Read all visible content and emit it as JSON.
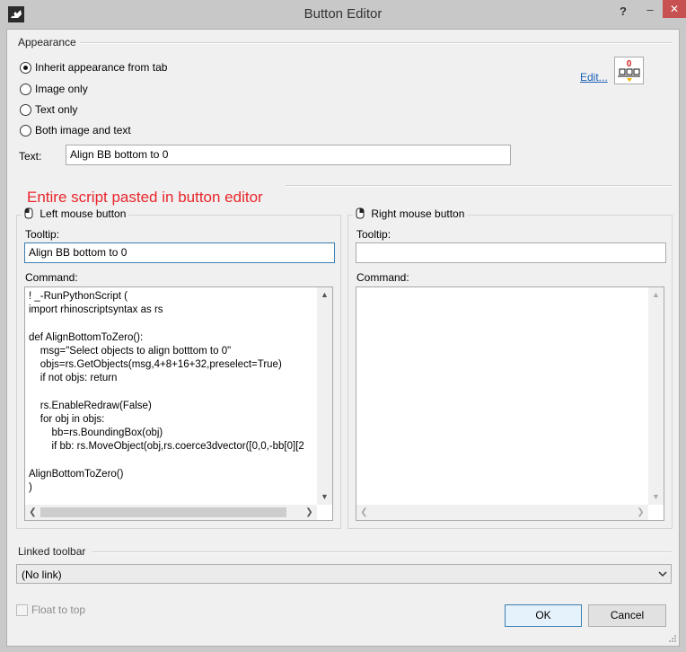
{
  "window": {
    "title": "Button Editor",
    "help_label": "?",
    "minimize_label": "–",
    "close_label": "✕",
    "close_color": "#c75050"
  },
  "appearance": {
    "section_label": "Appearance",
    "options": [
      {
        "label": "Inherit appearance from tab",
        "checked": true
      },
      {
        "label": "Image only",
        "checked": false
      },
      {
        "label": "Text only",
        "checked": false
      },
      {
        "label": "Both image and text",
        "checked": false
      }
    ],
    "edit_link": "Edit...",
    "text_label": "Text:",
    "text_value": "Align BB bottom to 0"
  },
  "annotation": {
    "text": "Entire script pasted in button editor",
    "color": "#e8262c"
  },
  "left_mouse": {
    "label": "Left mouse button",
    "tooltip_label": "Tooltip:",
    "tooltip_value": "Align BB bottom to 0",
    "command_label": "Command:",
    "command_lines": [
      "! _-RunPythonScript (",
      "import rhinoscriptsyntax as rs",
      "",
      "def AlignBottomToZero():",
      "    msg=\"Select objects to align botttom to 0\"",
      "    objs=rs.GetObjects(msg,4+8+16+32,preselect=True)",
      "    if not objs: return",
      "",
      "    rs.EnableRedraw(False)",
      "    for obj in objs:",
      "        bb=rs.BoundingBox(obj)",
      "        if bb: rs.MoveObject(obj,rs.coerce3dvector([0,0,-bb[0][2",
      "",
      "AlignBottomToZero()",
      ")"
    ]
  },
  "right_mouse": {
    "label": "Right mouse button",
    "tooltip_label": "Tooltip:",
    "tooltip_value": "",
    "command_label": "Command:"
  },
  "linked_toolbar": {
    "section_label": "Linked toolbar",
    "selected": "(No link)"
  },
  "float_to_top": {
    "label": "Float to top",
    "checked": false
  },
  "buttons": {
    "ok": "OK",
    "cancel": "Cancel"
  }
}
